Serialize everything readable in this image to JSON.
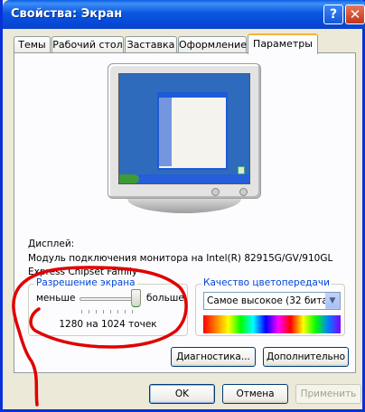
{
  "window": {
    "title": "Свойства: Экран"
  },
  "titlebar": {
    "help_label": "?",
    "close_label": "✕"
  },
  "tabs": [
    {
      "label": "Темы"
    },
    {
      "label": "Рабочий стол"
    },
    {
      "label": "Заставка"
    },
    {
      "label": "Оформление"
    },
    {
      "label": "Параметры",
      "active": true
    }
  ],
  "display": {
    "label": "Дисплей:",
    "value": "Модуль подключения монитора на Intel(R) 82915G/GV/910GL Express Chipset Family"
  },
  "resolution": {
    "group_title": "Разрешение экрана",
    "less_label": "меньше",
    "more_label": "больше",
    "value_text": "1280 на 1024 точек",
    "slider_level": 0.92
  },
  "color_quality": {
    "group_title": "Качество цветопередачи",
    "selected": "Самое высокое (32 бита)"
  },
  "buttons": {
    "diagnostics": "Диагностика...",
    "advanced": "Дополнительно",
    "ok": "OK",
    "cancel": "Отмена",
    "apply": "Применить"
  },
  "annotation": {
    "color": "#e00000"
  }
}
